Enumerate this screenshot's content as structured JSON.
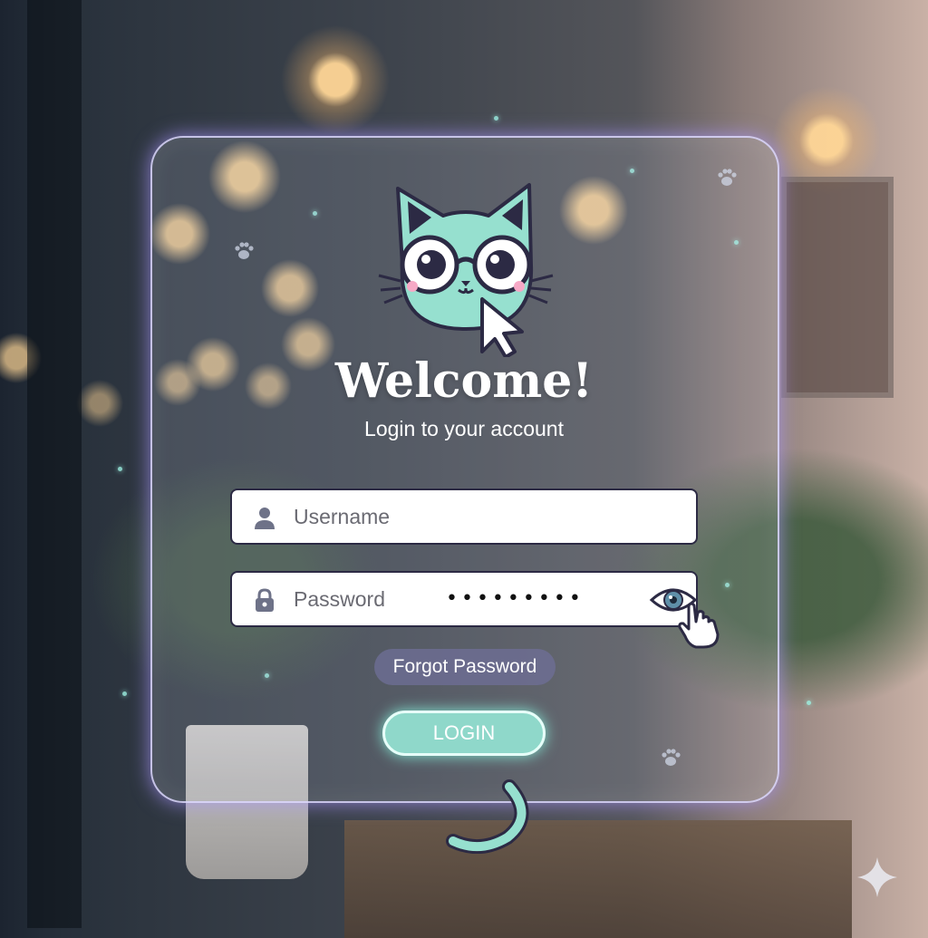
{
  "login_card": {
    "title": "Welcome!",
    "subtitle": "Login to your account",
    "username": {
      "placeholder": "Username",
      "value": ""
    },
    "password": {
      "placeholder": "Password",
      "masked_value": "•••••••••"
    },
    "forgot_password_label": "Forgot Password",
    "login_button_label": "LOGIN"
  },
  "icons": {
    "mascot": "cat-with-glasses-icon",
    "pointer": "cursor-arrow-icon",
    "username": "user-icon",
    "password": "lock-icon",
    "toggle_visibility": "eye-icon",
    "hand": "pointing-hand-icon",
    "decoration": "paw-print-icon",
    "corner": "sparkle-icon"
  },
  "colors": {
    "accent": "#8fd8ca",
    "card_border": "#dcd7ff",
    "field_border": "#2c2a44",
    "forgot_bg": "#6e6e96"
  }
}
